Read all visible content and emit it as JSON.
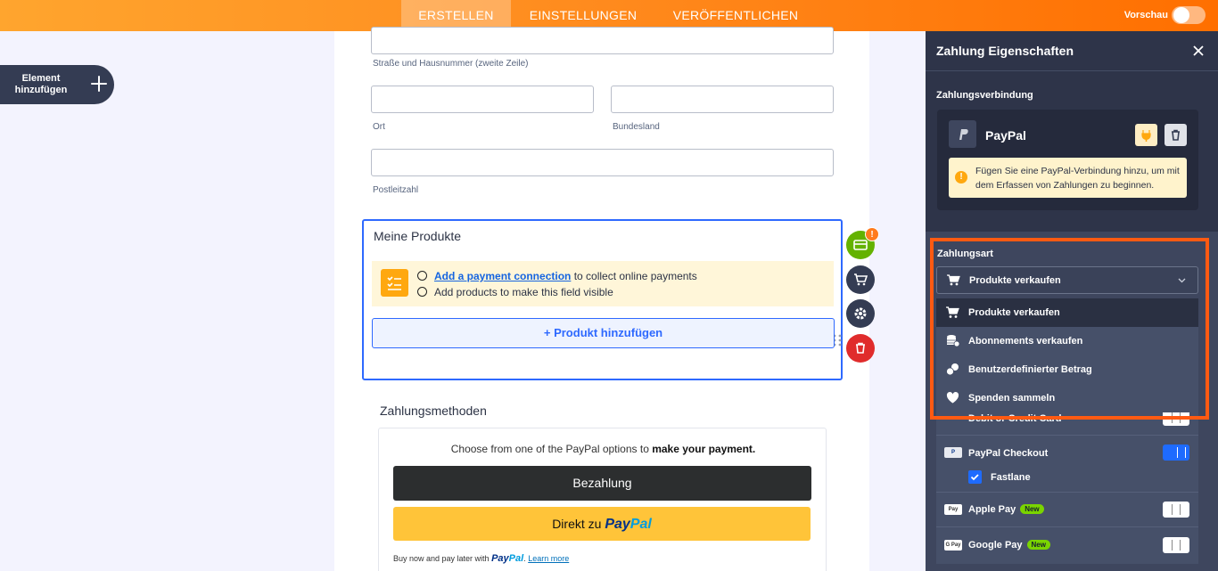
{
  "topbar": {
    "tabs": [
      {
        "label": "ERSTELLEN",
        "active": true
      },
      {
        "label": "EINSTELLUNGEN",
        "active": false
      },
      {
        "label": "VERÖFFENTLICHEN",
        "active": false
      }
    ],
    "preview_label": "Vorschau",
    "preview_on": false
  },
  "left": {
    "add_element_label": "Element hinzufügen"
  },
  "form": {
    "address_line2_label": "Straße und Hausnummer (zweite Zeile)",
    "city_label": "Ort",
    "state_label": "Bundesland",
    "zip_label": "Postleitzahl",
    "products": {
      "title": "Meine Produkte",
      "notice_link": "Add a payment connection",
      "notice_line1_rest": " to collect online payments",
      "notice_line2": "Add products to make this field visible",
      "add_product_button": "+ Produkt hinzufügen"
    },
    "payment_methods": {
      "title": "Zahlungsmethoden",
      "choose_text": "Choose from one of the PayPal options to ",
      "choose_bold": "make your payment.",
      "pay_button": "Bezahlung",
      "direct_prefix": "Direkt zu ",
      "paypal_pay": "Pay",
      "paypal_pal": "Pal",
      "later_prefix": "Buy now and pay later with ",
      "later_suffix": ".",
      "learn_more": "Learn more"
    },
    "side_badge": "!"
  },
  "panel": {
    "title": "Zahlung Eigenschaften",
    "connection_label": "Zahlungsverbindung",
    "provider_name": "PayPal",
    "warning_text": "Fügen Sie eine PayPal-Verbindung hinzu, um mit dem Erfassen von Zahlungen zu beginnen.",
    "payment_type_label": "Zahlungsart",
    "selected_type": "Produkte verkaufen",
    "dropdown_options": [
      {
        "label": "Produkte verkaufen",
        "icon": "cart-icon",
        "selected": true
      },
      {
        "label": "Abonnements verkaufen",
        "icon": "coins-icon",
        "selected": false
      },
      {
        "label": "Benutzerdefinierter Betrag",
        "icon": "donate-coins-icon",
        "selected": false
      },
      {
        "label": "Spenden sammeln",
        "icon": "heart-icon",
        "selected": false
      }
    ],
    "methods": {
      "partial_row": "Debit or Credit Card",
      "paypal_checkout": "PayPal Checkout",
      "paypal_checkout_on": true,
      "fastlane": "Fastlane",
      "fastlane_checked": true,
      "apple_pay": "Apple Pay",
      "apple_pay_mini": "Pay",
      "google_pay": "Google Pay",
      "google_pay_mini": "G Pay",
      "new_badge": "New"
    }
  },
  "colors": {
    "accent_orange": "#ff6f00",
    "highlight": "#ff5a12",
    "primary_blue": "#2e69ff",
    "panel_bg": "#3e465e"
  }
}
